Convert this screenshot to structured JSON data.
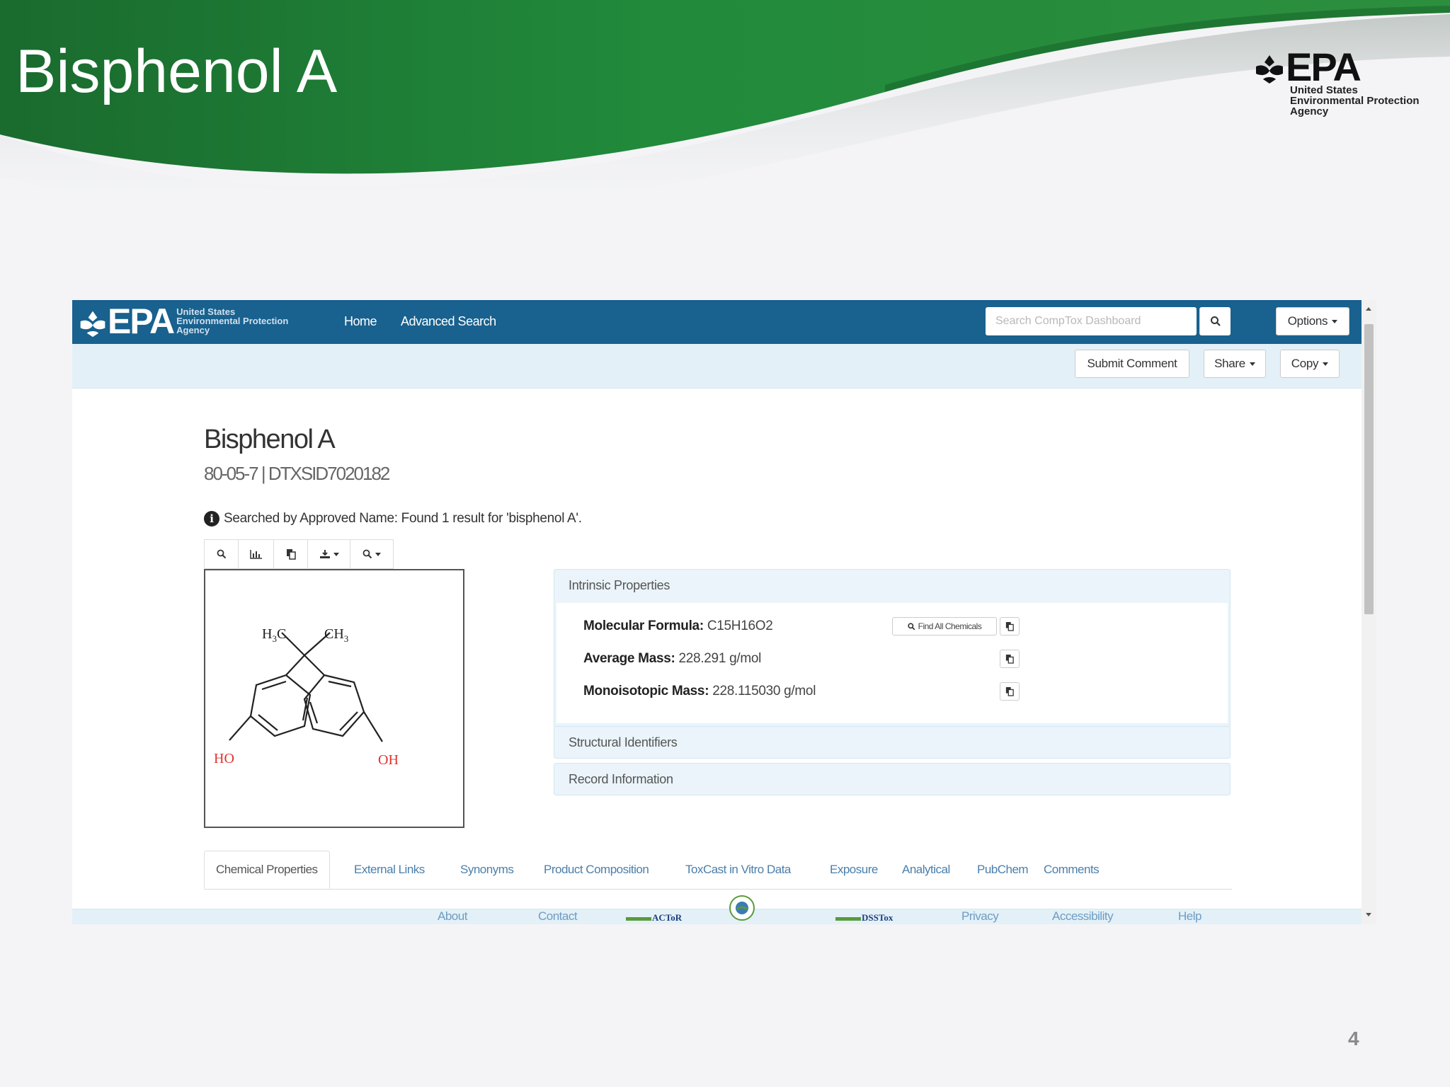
{
  "slide": {
    "title": "Bisphenol A",
    "page_number": "4",
    "logo": {
      "wordmark": "EPA",
      "subtitle_lines": [
        "United States",
        "Environmental Protection",
        "Agency"
      ]
    }
  },
  "app": {
    "nav": {
      "logo_wordmark": "EPA",
      "logo_subtitle_lines": [
        "United States",
        "Environmental Protection",
        "Agency"
      ],
      "links": [
        "Home",
        "Advanced Search"
      ],
      "search_placeholder": "Search CompTox Dashboard",
      "options_label": "Options"
    },
    "subbar": {
      "submit_comment": "Submit Comment",
      "share": "Share",
      "copy": "Copy"
    },
    "chemical": {
      "name": "Bisphenol A",
      "ids": "80-05-7 | DTXSID7020182",
      "search_note": "Searched by Approved Name: Found 1 result for 'bisphenol A'."
    },
    "structure": {
      "toolbar_icons": [
        "zoom-in-icon",
        "chart-icon",
        "copy-icon",
        "download-icon",
        "search-icon"
      ],
      "labels": {
        "methyl_left": "H3C",
        "methyl_right": "CH3",
        "hydroxyl_left": "HO",
        "hydroxyl_right": "OH"
      }
    },
    "panels": {
      "intrinsic": {
        "title": "Intrinsic Properties",
        "find_all_label": "Find All Chemicals",
        "rows": [
          {
            "label": "Molecular Formula:",
            "value": "C15H16O2"
          },
          {
            "label": "Average Mass:",
            "value": "228.291 g/mol"
          },
          {
            "label": "Monoisotopic Mass:",
            "value": "228.115030 g/mol"
          }
        ]
      },
      "structural": {
        "title": "Structural Identifiers"
      },
      "record": {
        "title": "Record Information"
      }
    },
    "tabs": [
      "Chemical Properties",
      "External Links",
      "Synonyms",
      "Product Composition",
      "ToxCast in Vitro Data",
      "Exposure",
      "Analytical",
      "PubChem",
      "Comments"
    ],
    "active_tab": "Chemical Properties",
    "footer": {
      "links": [
        "About",
        "Contact",
        "Privacy",
        "Accessibility",
        "Help"
      ],
      "logos": [
        "ACToR",
        "DSSTox"
      ]
    }
  },
  "colors": {
    "header_green": "#1e7a34",
    "nav_blue": "#19618e",
    "subbar_blue": "#e3f0f8",
    "link_blue": "#4a7fab",
    "structure_red": "#e0332e"
  }
}
